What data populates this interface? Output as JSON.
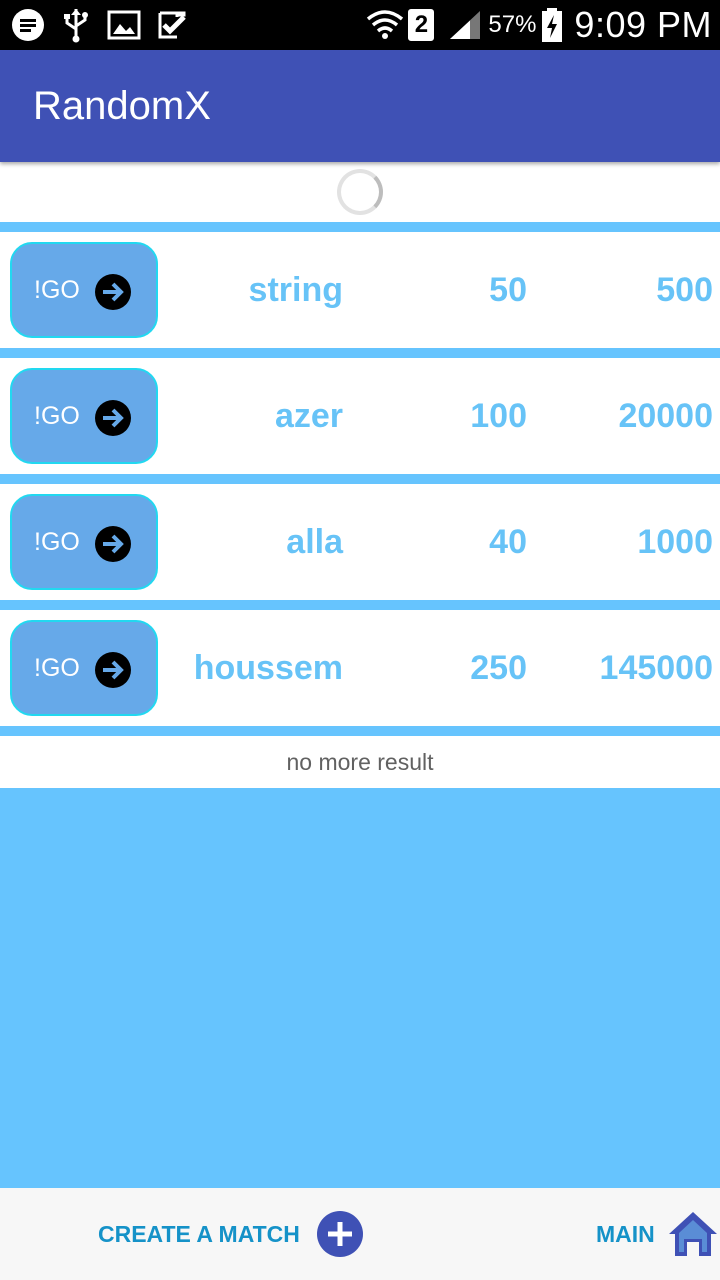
{
  "status_bar": {
    "battery_percent": "57%",
    "sim_slot": "2",
    "time": "9:09 PM",
    "icons": [
      "messenger-icon",
      "usb-icon",
      "image-icon",
      "check-icon",
      "wifi-icon",
      "signal-icon",
      "battery-icon"
    ]
  },
  "app_bar": {
    "title": "RandomX"
  },
  "list": {
    "items": [
      {
        "go_label": "!GO",
        "name": "string",
        "value1": "50",
        "value2": "500"
      },
      {
        "go_label": "!GO",
        "name": "azer",
        "value1": "100",
        "value2": "20000"
      },
      {
        "go_label": "!GO",
        "name": "alla",
        "value1": "40",
        "value2": "1000"
      },
      {
        "go_label": "!GO",
        "name": "houssem",
        "value1": "250",
        "value2": "145000"
      }
    ],
    "footer_text": "no more result"
  },
  "bottom_bar": {
    "create_label": "CREATE A MATCH",
    "main_label": "MAIN"
  },
  "colors": {
    "app_bar": "#3f51b5",
    "background": "#66c4fe",
    "go_button": "#66a9e9",
    "go_border": "#22d8f0",
    "value_text": "#67c3f7",
    "bottom_label": "#1592c8",
    "bottom_icon": "#3f51b5"
  }
}
